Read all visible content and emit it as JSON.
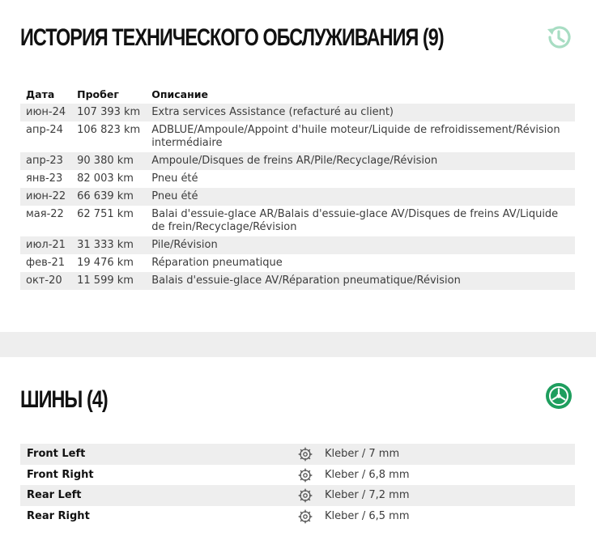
{
  "maintenance": {
    "title": "ИСТОРИЯ ТЕХНИЧЕСКОГО ОБСЛУЖИВАНИЯ (9)",
    "icon": "history-icon",
    "headers": {
      "date": "Дата",
      "mileage": "Пробег",
      "description": "Описание"
    },
    "rows": [
      {
        "date": "июн-24",
        "mileage": "107 393 km",
        "description": "Extra services Assistance (refacturé au client)"
      },
      {
        "date": "апр-24",
        "mileage": "106 823 km",
        "description": "ADBLUE/Ampoule/Appoint d'huile moteur/Liquide de refroidissement/Révision intermédiaire"
      },
      {
        "date": "апр-23",
        "mileage": "90 380 km",
        "description": "Ampoule/Disques de freins AR/Pile/Recyclage/Révision"
      },
      {
        "date": "янв-23",
        "mileage": "82 003 km",
        "description": "Pneu été"
      },
      {
        "date": "июн-22",
        "mileage": "66 639 km",
        "description": "Pneu été"
      },
      {
        "date": "мая-22",
        "mileage": "62 751 km",
        "description": "Balai d'essuie-glace AR/Balais d'essuie-glace AV/Disques de freins AV/Liquide de frein/Recyclage/Révision"
      },
      {
        "date": "июл-21",
        "mileage": "31 333 km",
        "description": "Pile/Révision"
      },
      {
        "date": "фев-21",
        "mileage": "19 476 km",
        "description": "Réparation pneumatique"
      },
      {
        "date": "окт-20",
        "mileage": "11 599 km",
        "description": "Balais d'essuie-glace AV/Réparation pneumatique/Révision"
      }
    ]
  },
  "tires": {
    "title": "ШИНЫ (4)",
    "icon": "tire-icon",
    "accent_color": "#1e9e5e",
    "rows": [
      {
        "position": "Front Left",
        "spec": "Kleber / 7 mm"
      },
      {
        "position": "Front Right",
        "spec": "Kleber / 6,8 mm"
      },
      {
        "position": "Rear Left",
        "spec": "Kleber / 7,2 mm"
      },
      {
        "position": "Rear Right",
        "spec": "Kleber / 6,5 mm"
      }
    ]
  }
}
